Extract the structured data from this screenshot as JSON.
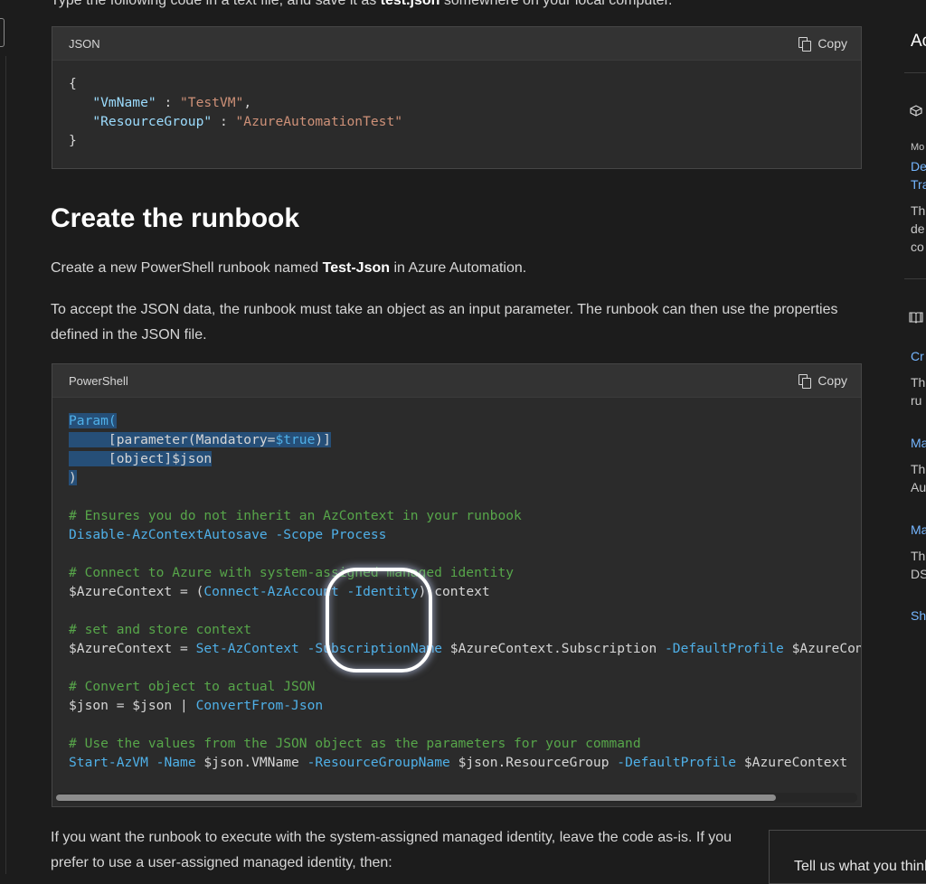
{
  "intro": {
    "before": "Type the following code in a text file, and save it as ",
    "bold": "test.json",
    "after": " somewhere on your local computer."
  },
  "json_block": {
    "language": "JSON",
    "copy_label": "Copy",
    "lines": {
      "open": "{",
      "l1_key": "\"VmName\"",
      "l1_sep": " : ",
      "l1_val": "\"TestVM\"",
      "l1_end": ",",
      "l2_key": "\"ResourceGroup\"",
      "l2_sep": " : ",
      "l2_val": "\"AzureAutomationTest\"",
      "close": "}"
    }
  },
  "section_heading": "Create the runbook",
  "para1": {
    "before": "Create a new PowerShell runbook named ",
    "bold": "Test-Json",
    "after": " in Azure Automation."
  },
  "para2": "To accept the JSON data, the runbook must take an object as an input parameter. The runbook can then use the properties defined in the JSON file.",
  "ps_block": {
    "language": "PowerShell",
    "copy_label": "Copy",
    "param_open": "Param(",
    "param_attr_a": "     [parameter(Mandatory=",
    "param_true": "$true",
    "param_attr_b": ")]",
    "param_obj": "     [object]$json",
    "param_close": ")",
    "c1": "# Ensures you do not inherit an AzContext in your runbook",
    "l1_cmd": "Disable-AzContextAutosave",
    "l1_param": "-Scope",
    "l1_val": "Process",
    "c2": "# Connect to Azure with system-assigned managed identity",
    "l2_a": "$AzureContext = (",
    "l2_cmd": "Connect-AzAccount",
    "l2_param": "-Identity",
    "l2_b": ").context",
    "c3": "# set and store context",
    "l3_a": "$AzureContext = ",
    "l3_cmd": "Set-AzContext",
    "l3_p1": "-SubscriptionName",
    "l3_b": " $AzureContext.Subscription ",
    "l3_p2": "-DefaultProfile",
    "l3_c": " $AzureContext",
    "c4": "# Convert object to actual JSON",
    "l4_a": "$json = $json | ",
    "l4_cmd": "ConvertFrom-Json",
    "c5": "# Use the values from the JSON object as the parameters for your command",
    "l5_cmd": "Start-AzVM",
    "l5_p1": "-Name",
    "l5_a": " $json.VMName ",
    "l5_p2": "-ResourceGroupName",
    "l5_b": " $json.ResourceGroup ",
    "l5_p3": "-DefaultProfile",
    "l5_c": " $AzureContext"
  },
  "para3": "If you want the runbook to execute with the system-assigned managed identity, leave the code as-is. If you prefer to use a user-assigned managed identity, then:",
  "right_rail": {
    "title": "Ac",
    "small_label": "Mo",
    "link1a": "De",
    "link1b": "Tra",
    "desc1a": "Th",
    "desc1b": "de",
    "desc1c": "co",
    "link2": "Cr",
    "desc2a": "Th",
    "desc2b": "ru",
    "link3": "Ma",
    "desc3a": "Th",
    "desc3b": "Au",
    "link4": "Ma",
    "desc4a": "Th",
    "desc4b": "DS",
    "link5": "Sh"
  },
  "feedback": "Tell us what you think"
}
